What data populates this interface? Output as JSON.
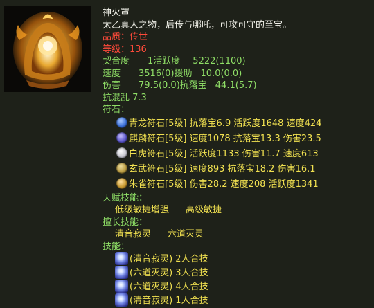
{
  "item": {
    "name": "神火罩",
    "description": "太乙真人之物，后传与哪吒，可攻可守的至宝。",
    "quality_label": "品质：",
    "quality_value": "传世",
    "level_label": "等级：",
    "level_value": "136"
  },
  "stats": {
    "affinity_label": "契合度",
    "affinity_value": "1活跃度",
    "affinity_extra": "5222(1100)",
    "speed_label": "速度",
    "speed_value": "3516(0)援助",
    "speed_extra": "10.0(0.0)",
    "damage_label": "伤害",
    "damage_value": "79.5(0.0)抗落宝",
    "damage_extra": "44.1(5.7)",
    "anti_chaos": "抗混乱 7.3"
  },
  "runes": {
    "header": "符石：",
    "items": [
      {
        "text": "青龙符石[5级] 抗落宝6.9 活跃度1648 速度424",
        "icon": "dragon-rune-icon",
        "color": "#3a6fd8"
      },
      {
        "text": "麒麟符石[5级] 速度1078 抗落宝13.3 伤害23.5",
        "icon": "qilin-rune-icon",
        "color": "#5a55c8"
      },
      {
        "text": "白虎符石[5级] 活跃度1133 伤害11.7 速度613",
        "icon": "tiger-rune-icon",
        "color": "#d8d8e0"
      },
      {
        "text": "玄武符石[5级] 速度893 抗落宝18.2 伤害16.1",
        "icon": "tortoise-rune-icon",
        "color": "#b89a40"
      },
      {
        "text": "朱雀符石[5级] 伤害28.2 速度208 活跃度1341",
        "icon": "phoenix-rune-icon",
        "color": "#c89a30"
      }
    ]
  },
  "talent": {
    "header": "天赋技能：",
    "skill1": "低级敏捷增强",
    "skill2": "高级敏捷"
  },
  "specialty": {
    "header": "擅长技能：",
    "skill1": "清音寂灵",
    "skill2": "六道灭灵"
  },
  "skills": {
    "header": "技能：",
    "items": [
      {
        "name": "(清音寂灵)",
        "desc": "2人合技"
      },
      {
        "name": "(六道灭灵)",
        "desc": "3人合技"
      },
      {
        "name": "(六道灭灵)",
        "desc": "4人合技"
      },
      {
        "name": "(清音寂灵)",
        "desc": "1人合技"
      }
    ]
  }
}
